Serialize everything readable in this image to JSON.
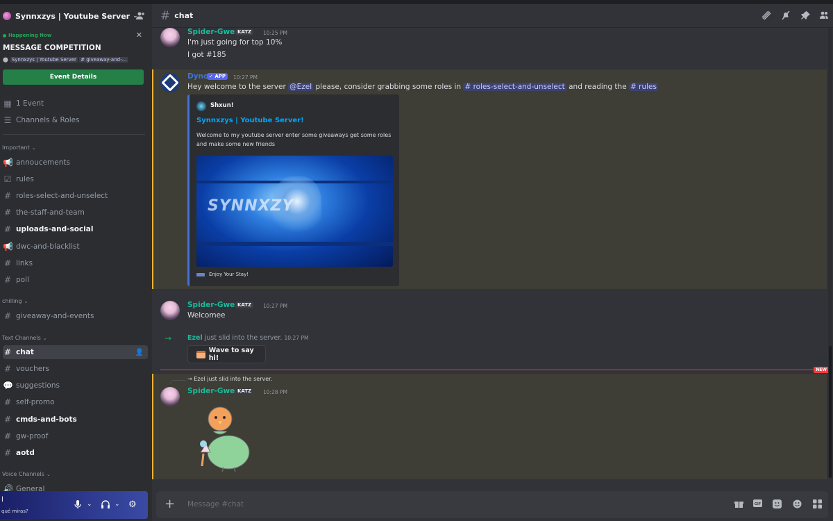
{
  "server": {
    "name": "Synnxzys | Youtube Server"
  },
  "event": {
    "happening_label": "Happening Now",
    "title": "MESSAGE COMPETITION",
    "location_server": "Synnxzys | Youtube Server",
    "location_channel": "# giveaway-and-...",
    "button": "Event Details"
  },
  "sidebar": {
    "top_items": [
      {
        "label": "1 Event",
        "icon": "calendar-icon"
      },
      {
        "label": "Channels & Roles",
        "icon": "list-icon"
      }
    ],
    "categories": {
      "important": "Important",
      "chilling": "chilling",
      "text": "Text Channels",
      "voice": "Voice Channels"
    },
    "important_channels": [
      {
        "label": "annoucements",
        "icon": "megaphone-icon"
      },
      {
        "label": "rules",
        "icon": "checkbox-icon"
      },
      {
        "label": "roles-select-and-unselect",
        "icon": "hash-icon"
      },
      {
        "label": "the-staff-and-team",
        "icon": "hash-icon"
      },
      {
        "label": "uploads-and-social",
        "icon": "hash-icon",
        "unread": true
      },
      {
        "label": "dwc-and-blacklist",
        "icon": "megaphone-icon"
      },
      {
        "label": "links",
        "icon": "hash-icon"
      },
      {
        "label": "poll",
        "icon": "hash-icon"
      }
    ],
    "chilling_channels": [
      {
        "label": "giveaway-and-events",
        "icon": "hash-icon"
      }
    ],
    "text_channels": [
      {
        "label": "chat",
        "icon": "hash-icon",
        "active": true
      },
      {
        "label": "vouchers",
        "icon": "hash-icon"
      },
      {
        "label": "suggestions",
        "icon": "forum-icon"
      },
      {
        "label": "self-promo",
        "icon": "hash-icon"
      },
      {
        "label": "cmds-and-bots",
        "icon": "hash-icon",
        "unread": true
      },
      {
        "label": "gw-proof",
        "icon": "hash-icon"
      },
      {
        "label": "aotd",
        "icon": "hash-icon",
        "unread": true
      }
    ],
    "voice_channels": [
      {
        "label": "General",
        "icon": "speaker-icon"
      }
    ]
  },
  "user": {
    "name": "l",
    "status": "qué miras?"
  },
  "channel": {
    "name": "chat"
  },
  "messages": {
    "m1": {
      "author": "Spider-Gwen",
      "tag": "KATZ",
      "time": "10:25 PM",
      "lines": [
        "I'm just going for top 10%",
        "I got #185"
      ]
    },
    "m2": {
      "author": "Dyno",
      "badge": "APP",
      "time": "10:27 PM",
      "text_a": "Hey welcome to the server ",
      "mention": "@Ezel",
      "text_b": " please, consider grabbing some roles in ",
      "chan1": "# roles-select-and-unselect",
      "text_c": " and reading the ",
      "chan2": "# rules",
      "embed": {
        "author": "Shxun!",
        "title": "Synnxzys | Youtube Server!",
        "description": "Welcome to my youtube server enter some giveaways get some roles and make some new friends",
        "image_text": "SYNNXZY",
        "footer": "Enjoy Your Stay!"
      }
    },
    "m3": {
      "author": "Spider-Gwen",
      "tag": "KATZ",
      "time": "10:27 PM",
      "text": "Welcomee"
    },
    "join": {
      "user": "Ezel",
      "text": " just slid into the server.",
      "time": "10:27 PM",
      "button": "Wave to say hi!"
    },
    "new_label": "NEW",
    "m4": {
      "reply": "Ezel just slid into the server.",
      "author": "Spider-Gwen",
      "tag": "KATZ",
      "time": "10:28 PM"
    }
  },
  "composer": {
    "placeholder": "Message #chat"
  },
  "colors": {
    "accent_green": "#23a55a",
    "link_blue": "#00a8fc",
    "mention_bg": "#3c4270",
    "new_red": "#f23f43"
  }
}
